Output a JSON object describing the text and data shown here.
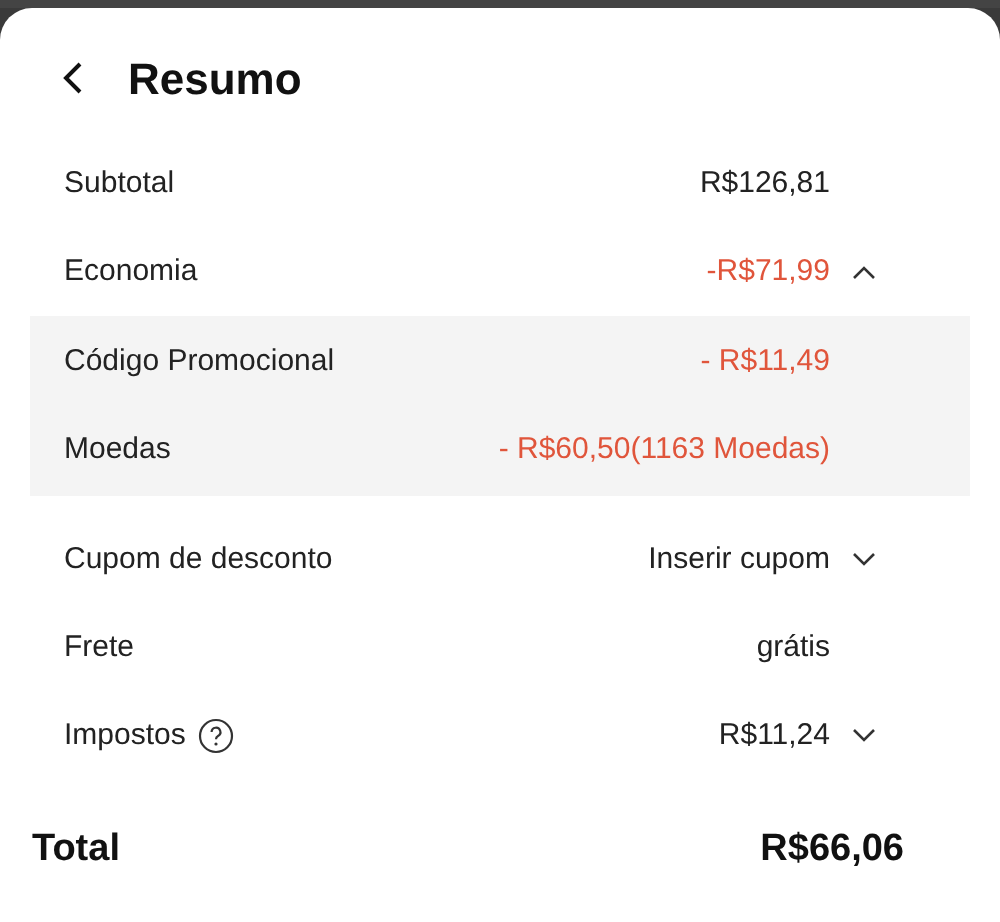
{
  "header": {
    "title": "Resumo"
  },
  "rows": [
    {
      "label": "Subtotal",
      "value": "R$126,81",
      "negative": false
    },
    {
      "label": "Economia",
      "value": "-R$71,99",
      "negative": true,
      "expanded": true,
      "children": [
        {
          "label": "Código Promocional",
          "value": "- R$11,49",
          "negative": true
        },
        {
          "label": "Moedas",
          "value": "- R$60,50(1163 Moedas)",
          "negative": true
        }
      ]
    },
    {
      "label": "Cupom de desconto",
      "value": "Inserir cupom",
      "negative": false,
      "expanded": false
    },
    {
      "label": "Frete",
      "value": "grátis",
      "negative": false
    },
    {
      "label": "Impostos",
      "value": "R$11,24",
      "negative": false,
      "help": true,
      "expanded": false
    }
  ],
  "total": {
    "label": "Total",
    "value": "R$66,06"
  }
}
